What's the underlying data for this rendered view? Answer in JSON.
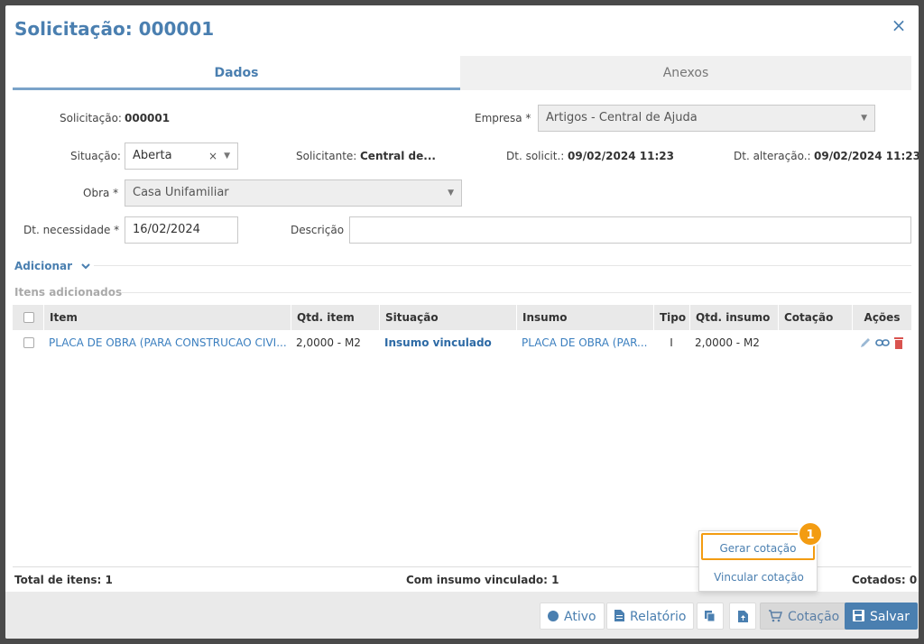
{
  "modal": {
    "title": "Solicitação: 000001",
    "close": "×"
  },
  "tabs": [
    {
      "label": "Dados"
    },
    {
      "label": "Anexos"
    }
  ],
  "form": {
    "solicitacao_label": "Solicitação:",
    "solicitacao_value": "000001",
    "empresa_label": "Empresa *",
    "empresa_value": "Artigos - Central de Ajuda",
    "situacao_label": "Situação:",
    "situacao_value": "Aberta",
    "solicitante_label": "Solicitante:",
    "solicitante_value": "Central de...",
    "dt_solicit_label": "Dt. solicit.:",
    "dt_solicit_value": "09/02/2024 11:23",
    "dt_alteracao_label": "Dt. alteração.:",
    "dt_alteracao_value": "09/02/2024 11:23",
    "obra_label": "Obra *",
    "obra_value": "Casa Unifamiliar",
    "dt_necessidade_label": "Dt. necessidade *",
    "dt_necessidade_value": "16/02/2024",
    "descricao_label": "Descrição",
    "descricao_value": ""
  },
  "adicionar": {
    "label": "Adicionar"
  },
  "itens_label": "Itens adicionados",
  "table": {
    "headers": [
      "Item",
      "Qtd. item",
      "Situação",
      "Insumo",
      "Tipo",
      "Qtd. insumo",
      "Cotação",
      "Ações"
    ],
    "rows": [
      {
        "item": "PLACA DE OBRA (PARA CONSTRUCAO CIVI...",
        "qtd_item": "2,0000 - M2",
        "situacao": "Insumo vinculado",
        "insumo": "PLACA DE OBRA (PAR...",
        "tipo": "I",
        "qtd_insumo": "2,0000 - M2",
        "cotacao": ""
      }
    ]
  },
  "footer": {
    "total": "Total de itens: 1",
    "vinculado": "Com insumo vinculado: 1",
    "cotados": "Cotados: 0"
  },
  "buttons": {
    "ativo": "Ativo",
    "relatorio": "Relatório",
    "cotacao": "Cotação",
    "salvar": "Salvar"
  },
  "popover": {
    "gerar": "Gerar cotação",
    "vincular": "Vincular cotação",
    "badge": "1"
  },
  "colors": {
    "accent": "#4a7fb0",
    "highlight": "#f39c12",
    "delete": "#d9534f"
  }
}
